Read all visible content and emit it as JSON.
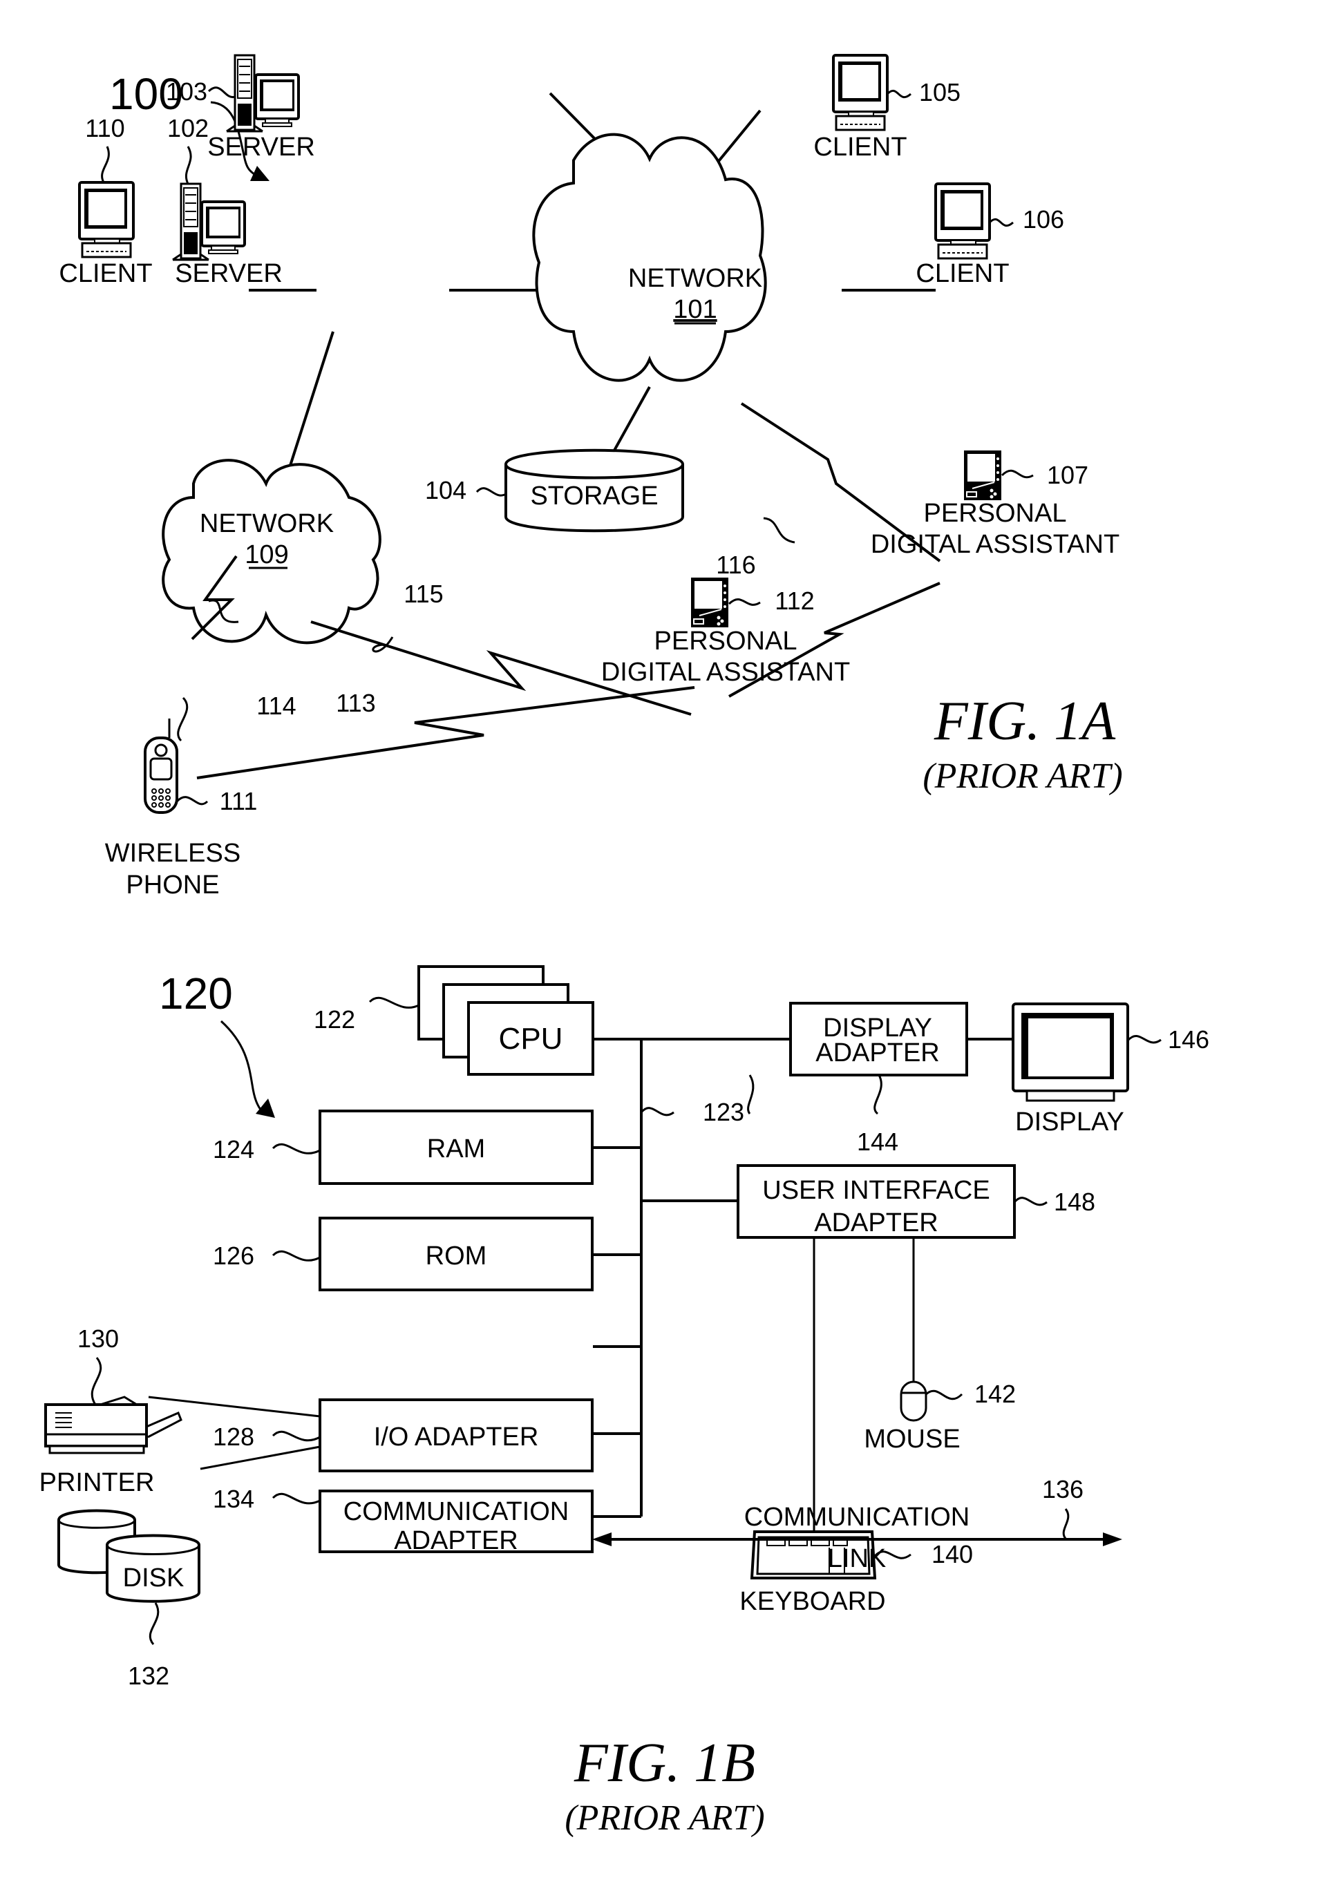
{
  "figure_1a": {
    "ref": "100",
    "title": "FIG. 1A",
    "subtitle": "(PRIOR ART)",
    "nodes": {
      "network_101": {
        "label": "NETWORK",
        "ref": "101"
      },
      "network_109": {
        "label": "NETWORK",
        "ref": "109"
      },
      "server_102": {
        "label": "SERVER",
        "ref": "102"
      },
      "server_103": {
        "label": "SERVER",
        "ref": "103"
      },
      "storage_104": {
        "label": "STORAGE",
        "ref": "104"
      },
      "client_105": {
        "label": "CLIENT",
        "ref": "105"
      },
      "client_106": {
        "label": "CLIENT",
        "ref": "106"
      },
      "client_110": {
        "label": "CLIENT",
        "ref": "110"
      },
      "pda_107": {
        "label_line1": "PERSONAL",
        "label_line2": "DIGITAL ASSISTANT",
        "ref": "107"
      },
      "pda_112": {
        "label_line1": "PERSONAL",
        "label_line2": "DIGITAL ASSISTANT",
        "ref": "112"
      },
      "phone_111": {
        "label_line1": "WIRELESS",
        "label_line2": "PHONE",
        "ref": "111"
      }
    },
    "wireless_links": {
      "link_113": "113",
      "link_114": "114",
      "link_115": "115",
      "link_116": "116"
    }
  },
  "figure_1b": {
    "ref": "120",
    "title": "FIG. 1B",
    "subtitle": "(PRIOR ART)",
    "bus_ref": "123",
    "nodes": {
      "cpu": {
        "label": "CPU",
        "ref": "122"
      },
      "ram": {
        "label": "RAM",
        "ref": "124"
      },
      "rom": {
        "label": "ROM",
        "ref": "126"
      },
      "io_adapter": {
        "label": "I/O ADAPTER",
        "ref": "128"
      },
      "comm_adapter": {
        "label_line1": "COMMUNICATION",
        "label_line2": "ADAPTER",
        "ref": "134"
      },
      "printer": {
        "label": "PRINTER",
        "ref": "130"
      },
      "disk": {
        "label": "DISK",
        "ref": "132"
      },
      "display_adapter": {
        "label_line1": "DISPLAY",
        "label_line2": "ADAPTER",
        "ref": "144"
      },
      "display": {
        "label": "DISPLAY",
        "ref": "146"
      },
      "ui_adapter": {
        "label_line1": "USER INTERFACE",
        "label_line2": "ADAPTER",
        "ref": "148"
      },
      "mouse": {
        "label": "MOUSE",
        "ref": "142"
      },
      "keyboard": {
        "label": "KEYBOARD",
        "ref": "140"
      },
      "comm_link": {
        "label_line1": "COMMUNICATION",
        "label_line2": "LINK",
        "ref": "136"
      }
    }
  }
}
